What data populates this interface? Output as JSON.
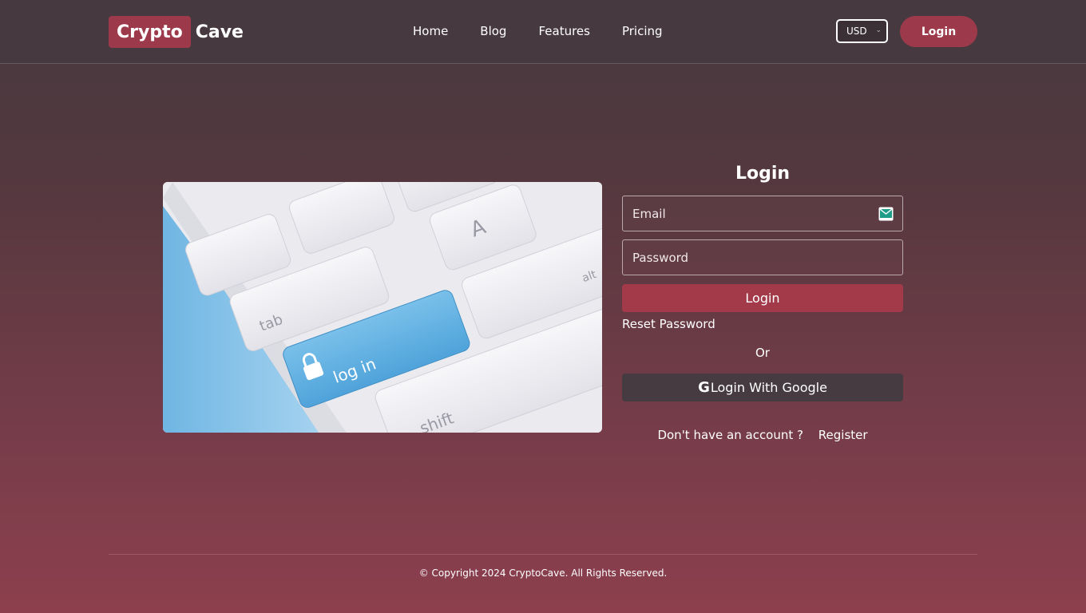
{
  "brand": {
    "logo_highlight": "Crypto",
    "logo_rest": "Cave",
    "accent_color": "#9c3a4b"
  },
  "nav": {
    "items": [
      {
        "label": "Home"
      },
      {
        "label": "Blog"
      },
      {
        "label": "Features"
      },
      {
        "label": "Pricing"
      }
    ]
  },
  "header": {
    "currency_selected": "USD",
    "login_label": "Login",
    "progress_fraction": 0.2
  },
  "hero": {
    "image_key_text": "log in",
    "image_tab_text": "tab",
    "image_shift_text": "shift",
    "image_a_text": "A",
    "image_alt_text": "alt"
  },
  "login_form": {
    "title": "Login",
    "email_placeholder": "Email",
    "password_placeholder": "Password",
    "submit_label": "Login",
    "reset_password_label": "Reset Password",
    "or_label": "Or",
    "google_icon": "G",
    "google_label": "Login With Google",
    "no_account_label": "Don't have an account ?",
    "register_label": "Register"
  },
  "footer": {
    "copyright": "© Copyright 2024 CryptoCave. All Rights Reserved."
  }
}
